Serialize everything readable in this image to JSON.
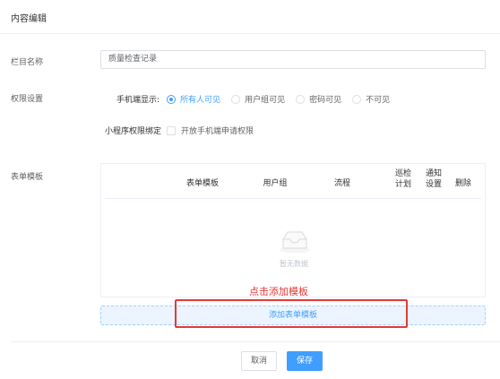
{
  "header": {
    "title": "内容编辑"
  },
  "column_name": {
    "label": "栏目名称",
    "value": "质量检查记录"
  },
  "permissions": {
    "label": "权限设置",
    "mobile_display_label": "手机端显示:",
    "options": [
      "所有人可见",
      "用户组可见",
      "密码可见",
      "不可见"
    ],
    "selected": "所有人可见",
    "mini_program_label": "小程序权限绑定",
    "mobile_apply_label": "开放手机端申请权限"
  },
  "form_template": {
    "label": "表单模板",
    "columns": [
      "表单模板",
      "用户组",
      "流程",
      "巡检\n计划",
      "通知\n设置",
      "删除"
    ],
    "empty_text": "暂无数据",
    "hint": "点击添加模板",
    "add_button": "添加表单模板"
  },
  "footer": {
    "cancel": "取消",
    "save": "保存"
  },
  "colors": {
    "primary": "#409eff",
    "highlight": "#e53935"
  }
}
